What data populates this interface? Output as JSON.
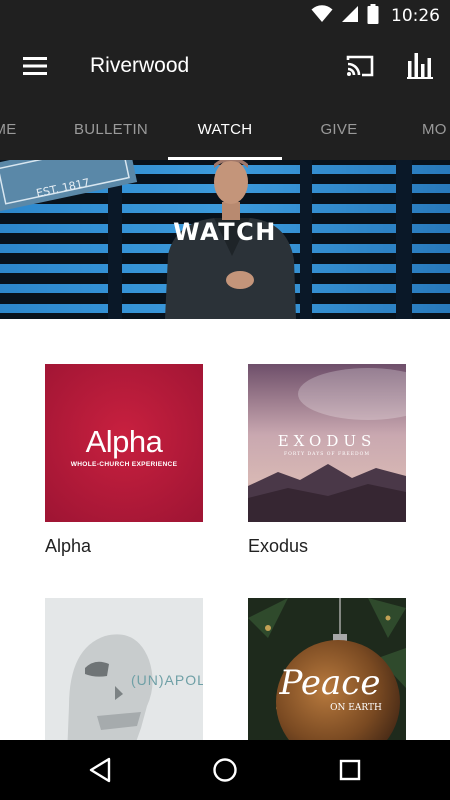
{
  "status_bar": {
    "time": "10:26",
    "icons": [
      "wifi-icon",
      "cell-signal-icon",
      "battery-icon"
    ]
  },
  "app_bar": {
    "title": "Riverwood",
    "icons": [
      "menu-icon",
      "cast-icon",
      "bar-chart-icon"
    ]
  },
  "tabs": [
    {
      "label": "ME"
    },
    {
      "label": "BULLETIN"
    },
    {
      "label": "WATCH"
    },
    {
      "label": "GIVE"
    },
    {
      "label": "MO"
    }
  ],
  "active_tab": "WATCH",
  "hero": {
    "title": "WATCH",
    "sign_text": "EST. 1817"
  },
  "series": [
    {
      "label": "Alpha",
      "art_title": "Alpha",
      "art_subtitle": "WHOLE-CHURCH EXPERIENCE"
    },
    {
      "label": "Exodus",
      "art_title": "EXODUS",
      "art_subtitle": "FORTY DAYS OF FREEDOM"
    },
    {
      "label": "",
      "art_title": "(UN)APOL"
    },
    {
      "label": "",
      "art_title": "Peace",
      "art_subtitle": "ON EARTH"
    }
  ],
  "nav_bar": {
    "icons": [
      "back-icon",
      "home-icon",
      "recents-icon"
    ]
  },
  "colors": {
    "bar_background": "#202020",
    "alpha_red": "#b41a3c",
    "tab_inactive": "#9a9a9a"
  }
}
